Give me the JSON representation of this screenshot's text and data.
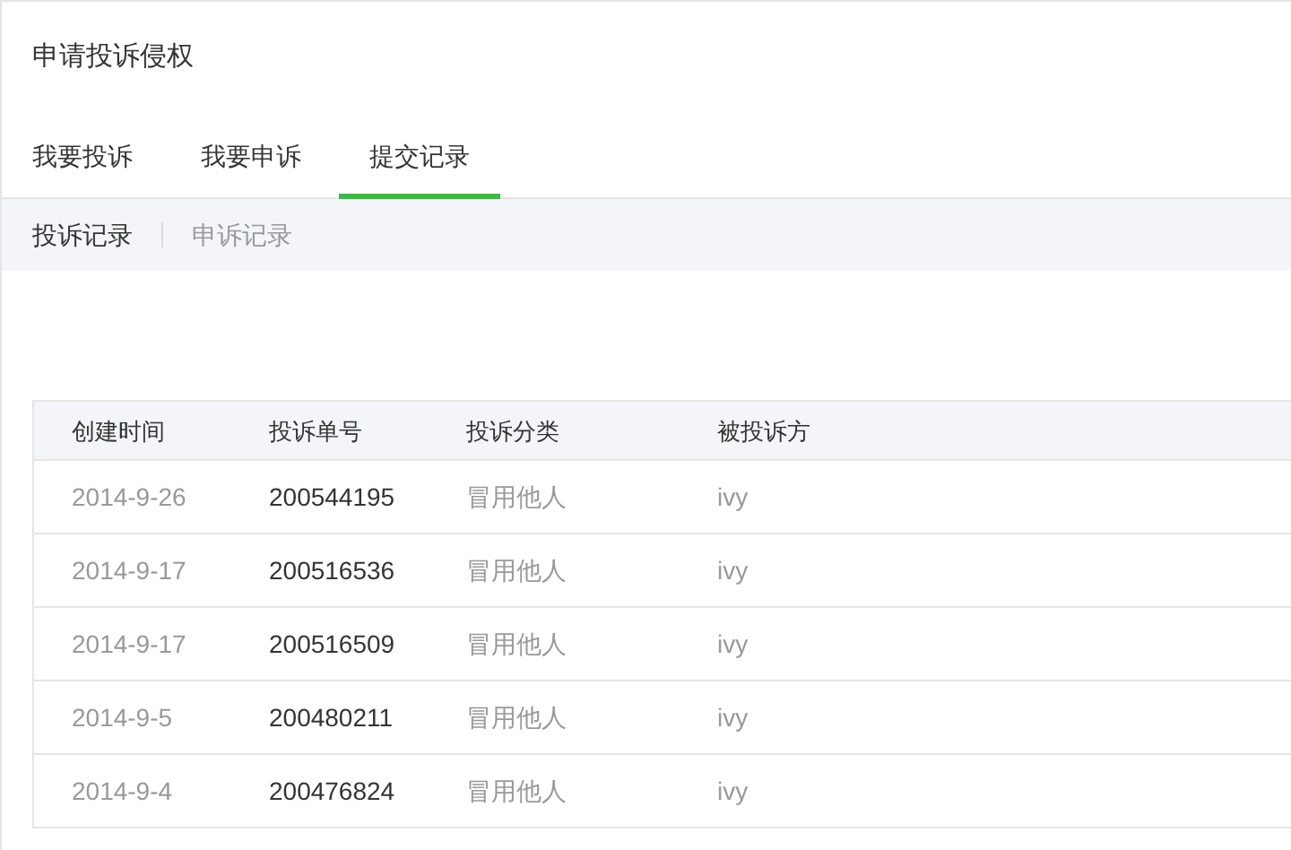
{
  "title": "申请投诉侵权",
  "tabs": [
    {
      "label": "我要投诉",
      "selected": false
    },
    {
      "label": "我要申诉",
      "selected": false
    },
    {
      "label": "提交记录",
      "selected": true
    }
  ],
  "subtabs": [
    {
      "label": "投诉记录",
      "selected": true
    },
    {
      "label": "申诉记录",
      "selected": false
    }
  ],
  "table": {
    "columns": [
      "创建时间",
      "投诉单号",
      "投诉分类",
      "被投诉方"
    ],
    "rows": [
      [
        "2014-9-26",
        "200544195",
        "冒用他人",
        "ivy"
      ],
      [
        "2014-9-17",
        "200516536",
        "冒用他人",
        "ivy"
      ],
      [
        "2014-9-17",
        "200516509",
        "冒用他人",
        "ivy"
      ],
      [
        "2014-9-5",
        "200480211",
        "冒用他人",
        "ivy"
      ],
      [
        "2014-9-4",
        "200476824",
        "冒用他人",
        "ivy"
      ]
    ]
  }
}
